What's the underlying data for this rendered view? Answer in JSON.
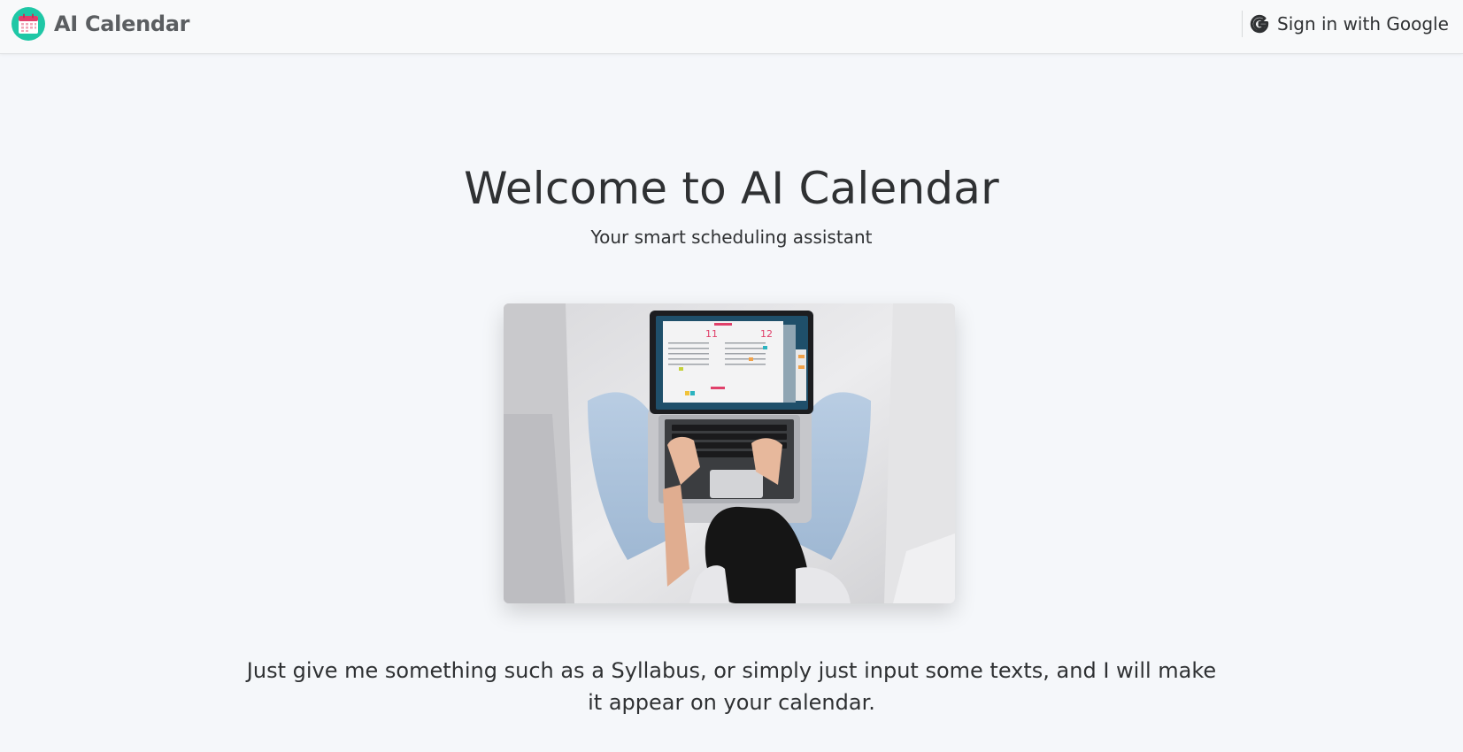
{
  "app": {
    "name": "AI Calendar",
    "logo_icon": "calendar-icon"
  },
  "navbar": {
    "signin_label": "Sign in with Google",
    "signin_icon": "google-g-icon"
  },
  "hero": {
    "title": "Welcome to AI Calendar",
    "subtitle": "Your smart scheduling assistant",
    "image": {
      "subject": "photo-person-using-laptop-calendar",
      "screen_numbers": [
        "11",
        "12"
      ]
    },
    "description": "Just give me something such as a Syllabus, or simply just input some texts, and I will make it appear on your calendar."
  },
  "colors": {
    "brand_teal": "#1fc7a6",
    "calendar_red": "#e0406a",
    "text_dark": "#2f3133",
    "brand_text": "#5b5e61",
    "background": "#f5f7fa"
  }
}
